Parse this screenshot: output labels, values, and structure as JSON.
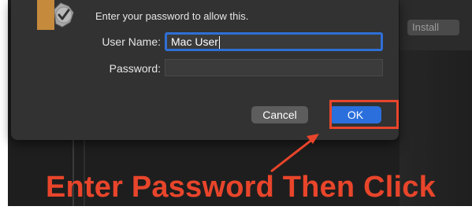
{
  "dialog": {
    "prompt": "Enter your password to allow this.",
    "user_name_label": "User Name:",
    "user_name_value": "Mac User",
    "password_label": "Password:",
    "password_value": "",
    "cancel_label": "Cancel",
    "ok_label": "OK",
    "icon": "lock-icon"
  },
  "background": {
    "install_label": "Install"
  },
  "annotation": {
    "caption": "Enter Password Then Click",
    "color": "#e8452b"
  },
  "colors": {
    "accent": "#2a6fdb",
    "dialog_bg": "#323232",
    "highlight": "#e8452b"
  }
}
